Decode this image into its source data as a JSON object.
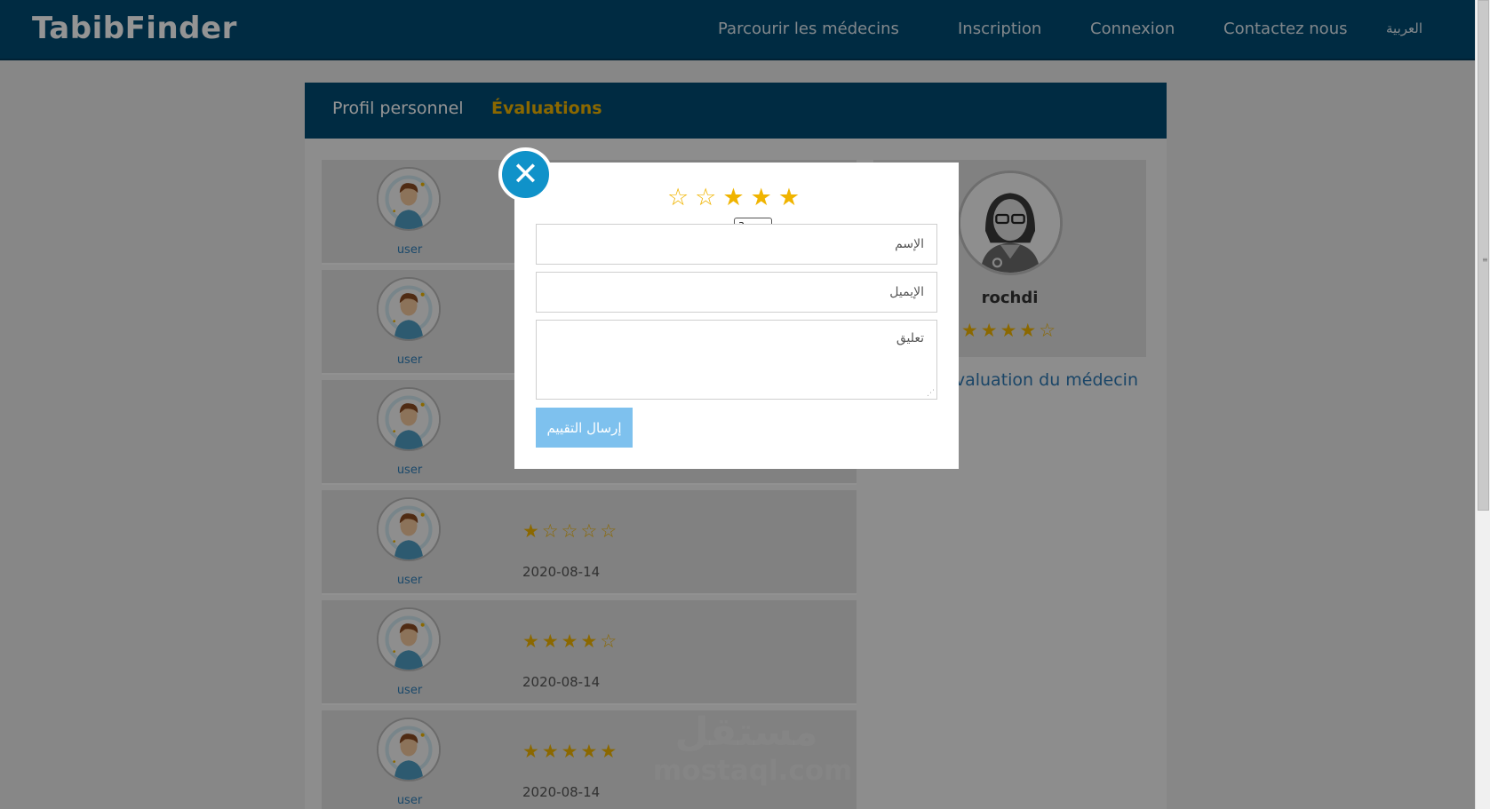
{
  "header": {
    "brand": "TabibFinder",
    "nav": {
      "browse": "Parcourir les médecins",
      "register": "Inscription",
      "login": "Connexion",
      "contact": "Contactez nous",
      "language": "العربية"
    }
  },
  "tabs": {
    "profile": "Profil personnel",
    "reviews": "Évaluations"
  },
  "reviews": [
    {
      "user": "user",
      "stars": null,
      "date": ""
    },
    {
      "user": "user",
      "stars": null,
      "date": ""
    },
    {
      "user": "user",
      "stars": null,
      "date": ""
    },
    {
      "user": "user",
      "stars": 1,
      "date": "2020-08-14"
    },
    {
      "user": "user",
      "stars": 4,
      "date": "2020-08-14"
    },
    {
      "user": "user",
      "stars": 5,
      "date": "2020-08-14"
    }
  ],
  "doctor": {
    "name": "rochdi",
    "rating": 4,
    "evaluate_link": "Évaluation du médecin"
  },
  "modal": {
    "rating": 3,
    "tooltip": "3 نجوم",
    "name_placeholder": "الإسم",
    "email_placeholder": "الإيميل",
    "comment_placeholder": "تعليق",
    "submit_label": "إرسال التقييم"
  },
  "watermark": {
    "arabic": "مستقل",
    "latin": "mostaql.com"
  },
  "colors": {
    "navbar": "#004a73",
    "star": "#f0b400",
    "close_button": "#1092c9",
    "submit_button": "#7ec1ee"
  }
}
